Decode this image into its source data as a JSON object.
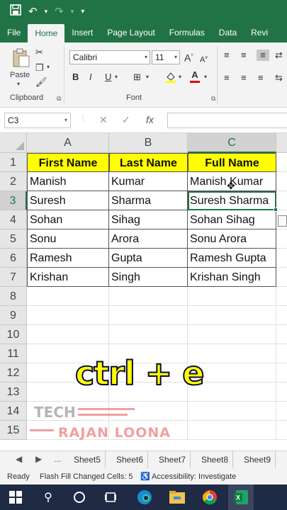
{
  "quick_access": {
    "save_icon": "save-icon",
    "undo_icon": "undo-icon",
    "redo_icon": "redo-icon",
    "customize_icon": "customize-qat-icon"
  },
  "ribbon_tabs": [
    "File",
    "Home",
    "Insert",
    "Page Layout",
    "Formulas",
    "Data",
    "Revi"
  ],
  "active_tab": "Home",
  "ribbon": {
    "clipboard": {
      "label": "Clipboard",
      "paste_label": "Paste"
    },
    "font": {
      "label": "Font",
      "font_name": "Calibri",
      "font_size": "11",
      "bold": "B",
      "italic": "I",
      "underline": "U",
      "font_color_letter": "A",
      "grow_font": "A",
      "shrink_font": "A"
    }
  },
  "formula_bar": {
    "name_box": "C3",
    "cancel": "✕",
    "enter": "✓",
    "fx": "fx",
    "value": ""
  },
  "columns": [
    "A",
    "B",
    "C"
  ],
  "selected_column": "C",
  "rows": [
    "1",
    "2",
    "3",
    "4",
    "5",
    "6",
    "7",
    "8",
    "9",
    "10",
    "11",
    "12",
    "13",
    "14",
    "15"
  ],
  "selected_row": "3",
  "table": {
    "headers": [
      "First Name",
      "Last Name",
      "Full Name"
    ],
    "data": [
      [
        "Manish",
        "Kumar",
        "Manish Kumar"
      ],
      [
        "Suresh",
        "Sharma",
        "Suresh Sharma"
      ],
      [
        "Sohan",
        "Sihag",
        "Sohan Sihag"
      ],
      [
        "Sonu",
        "Arora",
        "Sonu Arora"
      ],
      [
        "Ramesh",
        "Gupta",
        "Ramesh Gupta"
      ],
      [
        "Krishan",
        "Singh",
        "Krishan Singh"
      ]
    ]
  },
  "overlay": {
    "shortcut": "ctrl + e",
    "watermark_line1": "TECH",
    "watermark_line2": "RAJAN LOONA"
  },
  "sheet_tabs": {
    "ellipsis": "...",
    "tabs": [
      "Sheet5",
      "Sheet6",
      "Sheet7",
      "Sheet8",
      "Sheet9"
    ]
  },
  "status_bar": {
    "mode": "Ready",
    "flash_fill": "Flash Fill Changed Cells: 5",
    "accessibility": "Accessibility: Investigate"
  },
  "taskbar": {
    "icons": [
      "windows-start-icon",
      "search-icon",
      "cortana-icon",
      "task-view-icon",
      "edge-icon",
      "file-explorer-icon",
      "chrome-icon",
      "excel-icon"
    ]
  },
  "colors": {
    "excel_green": "#217346",
    "header_fill": "#ffff00",
    "taskbar": "#1f2a44"
  }
}
